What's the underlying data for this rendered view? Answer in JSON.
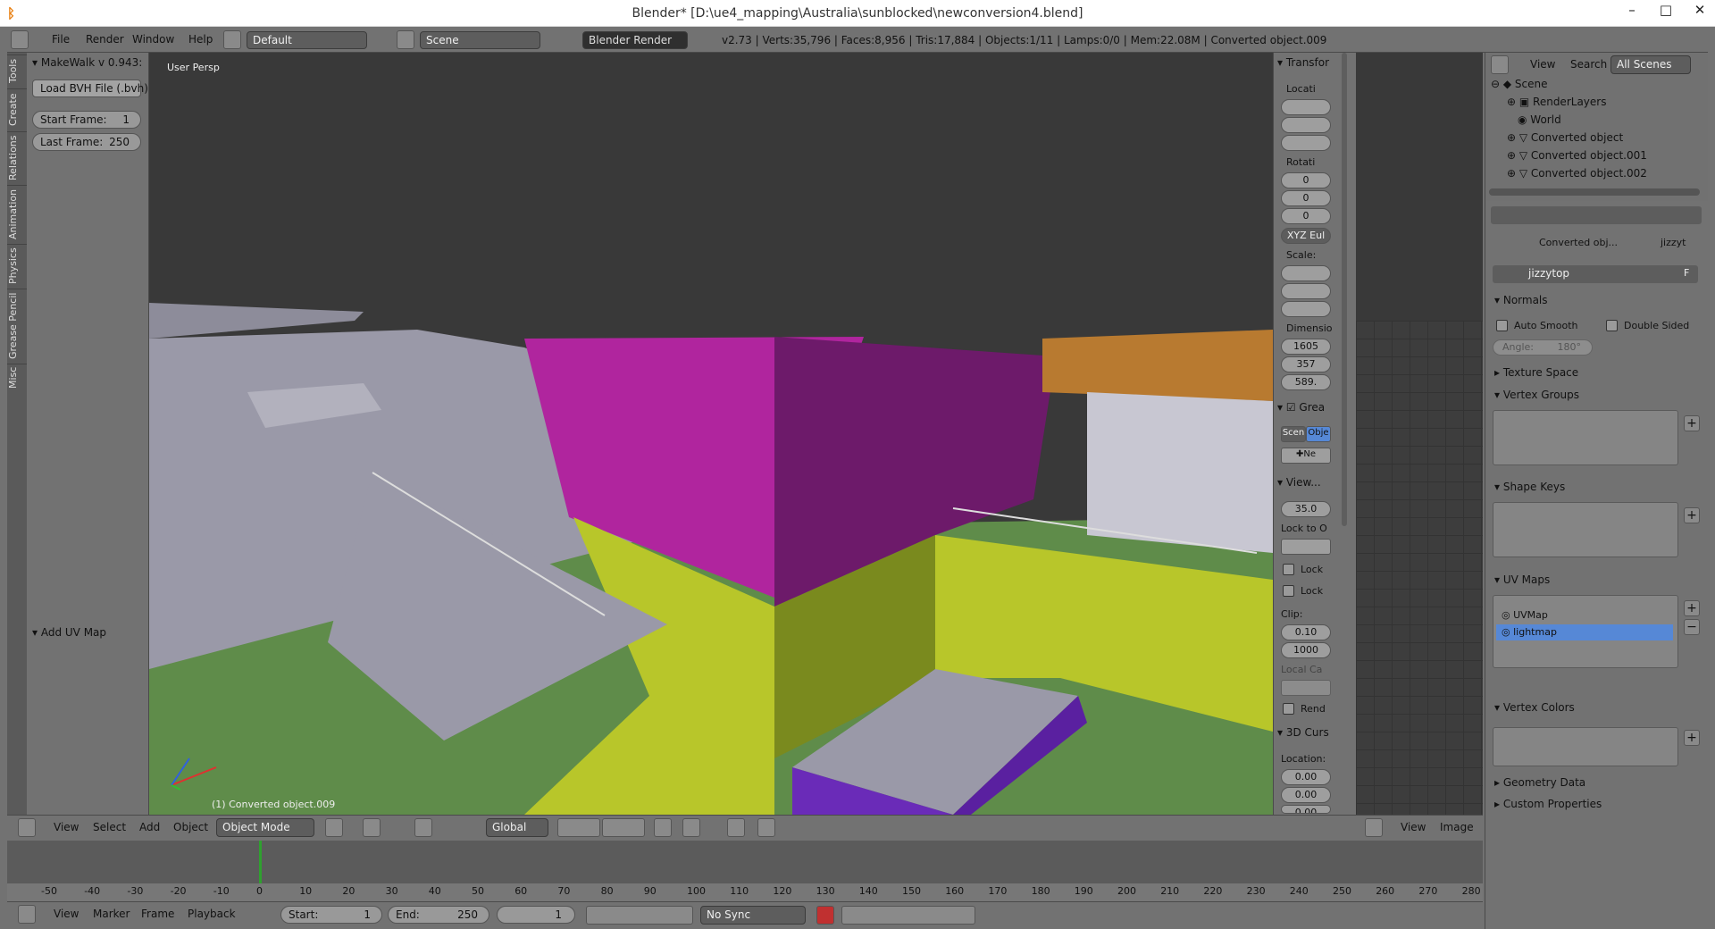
{
  "window": {
    "title": "Blender* [D:\\ue4_mapping\\Australia\\sunblocked\\newconversion4.blend]",
    "minimize": "–",
    "maximize": "□",
    "close": "✕"
  },
  "infobar": {
    "menus": [
      "File",
      "Render",
      "Window",
      "Help"
    ],
    "layout": "Default",
    "scene": "Scene",
    "engine": "Blender Render",
    "stats": "v2.73 | Verts:35,796 | Faces:8,956 | Tris:17,884 | Objects:1/11 | Lamps:0/0 | Mem:22.08M | Converted object.009"
  },
  "tool_tabs": [
    "Tools",
    "Create",
    "Relations",
    "Animation",
    "Physics",
    "Grease Pencil",
    "Misc"
  ],
  "tool_panel": {
    "header": "MakeWalk v 0.943:",
    "load_bvh": "Load BVH File (.bvh)",
    "start_label": "Start Frame:",
    "start_value": "1",
    "last_label": "Last Frame:",
    "last_value": "250",
    "add_uv_map": "Add UV Map"
  },
  "viewport": {
    "label": "User Persp",
    "object_label": "(1) Converted object.009"
  },
  "npanel": {
    "transform": "Transfor",
    "location": "Locati",
    "rotation": "Rotati",
    "rot_values": [
      "0",
      "0",
      "0"
    ],
    "rot_mode": "XYZ Eul",
    "scale": "Scale:",
    "dimensions": "Dimensio",
    "dim_values": [
      "1605",
      "357",
      "589."
    ],
    "grease": "Grea",
    "scene_tab": "Scen",
    "obj_tab": "Obje",
    "new_btn": "Ne",
    "view": "View...",
    "lens": "35.0",
    "lock_to": "Lock to O",
    "lock1": "Lock",
    "lock2": "Lock",
    "clip": "Clip:",
    "clip_start": "0.10",
    "clip_end": "1000",
    "local_cam": "Local Ca",
    "render": "Rend",
    "cursor": "3D Curs",
    "cursor_loc": "Location:",
    "cursor_values": [
      "0.00",
      "0.00",
      "0.00"
    ]
  },
  "outliner": {
    "view": "View",
    "search": "Search",
    "filter": "All Scenes",
    "rows": [
      "Scene",
      "RenderLayers",
      "World",
      "Converted object",
      "Converted object.001",
      "Converted object.002"
    ]
  },
  "properties": {
    "breadcrumb_obj": "Converted obj...",
    "breadcrumb_mesh": "jizzyt",
    "mesh_name": "jizzytop",
    "fake_user": "F",
    "normals": "Normals",
    "auto_smooth": "Auto Smooth",
    "double_sided": "Double Sided",
    "angle_label": "Angle:",
    "angle_value": "180°",
    "texture_space": "Texture Space",
    "vertex_groups": "Vertex Groups",
    "shape_keys": "Shape Keys",
    "uv_maps": "UV Maps",
    "uv_list": [
      "UVMap",
      "lightmap"
    ],
    "vertex_colors": "Vertex Colors",
    "geometry_data": "Geometry Data",
    "custom_properties": "Custom Properties"
  },
  "header3d": {
    "menus": [
      "View",
      "Select",
      "Add",
      "Object"
    ],
    "mode": "Object Mode",
    "orientation": "Global",
    "uv_view": "View",
    "uv_image": "Image"
  },
  "timeline": {
    "ticks": [
      "-50",
      "-40",
      "-30",
      "-20",
      "-10",
      "0",
      "10",
      "20",
      "30",
      "40",
      "50",
      "60",
      "70",
      "80",
      "90",
      "100",
      "110",
      "120",
      "130",
      "140",
      "150",
      "160",
      "170",
      "180",
      "190",
      "200",
      "210",
      "220",
      "230",
      "240",
      "250",
      "260",
      "270",
      "280"
    ],
    "menus": [
      "View",
      "Marker",
      "Frame",
      "Playback"
    ],
    "start_label": "Start:",
    "start_value": "1",
    "end_label": "End:",
    "end_value": "250",
    "current": "1",
    "sync": "No Sync"
  },
  "colors": {
    "magenta": "#b0259e",
    "magenta_dark": "#6d1a6a",
    "orange": "#b87a30",
    "yellow": "#b8c62a",
    "olive": "#7a8a1e",
    "ground": "#5f8c4a",
    "grey": "#9a99a8",
    "purple": "#6a2bb8",
    "selected": "#5688d6"
  }
}
